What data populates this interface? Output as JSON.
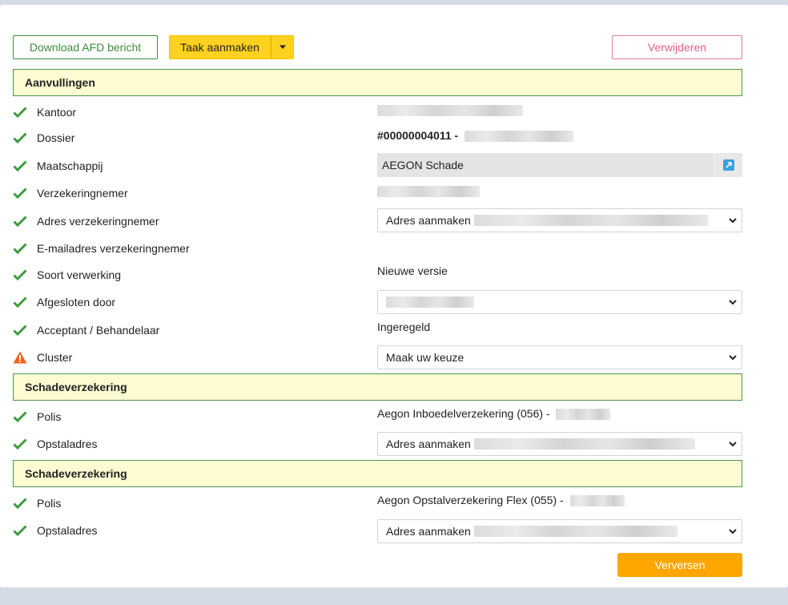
{
  "toolbar": {
    "download_label": "Download AFD bericht",
    "task_label": "Taak aanmaken",
    "delete_label": "Verwijderen"
  },
  "sections": [
    {
      "title": "Aanvullingen"
    },
    {
      "title": "Schadeverzekering"
    },
    {
      "title": "Schadeverzekering"
    }
  ],
  "aanvullingen": {
    "kantoor": {
      "label": "Kantoor"
    },
    "dossier": {
      "label": "Dossier",
      "value": "#00000004011 -"
    },
    "maatschappij": {
      "label": "Maatschappij",
      "value": "AEGON Schade"
    },
    "verzekeringnemer": {
      "label": "Verzekeringnemer"
    },
    "adres": {
      "label": "Adres verzekeringnemer",
      "value": "Adres aanmaken"
    },
    "email": {
      "label": "E-mailadres verzekeringnemer"
    },
    "soort": {
      "label": "Soort verwerking",
      "value": "Nieuwe versie"
    },
    "afgesloten": {
      "label": "Afgesloten door"
    },
    "acceptant": {
      "label": "Acceptant / Behandelaar",
      "value": "Ingeregeld"
    },
    "cluster": {
      "label": "Cluster",
      "value": "Maak uw keuze"
    }
  },
  "schade1": {
    "polis": {
      "label": "Polis",
      "value": "Aegon Inboedelverzekering (056) -"
    },
    "opstal": {
      "label": "Opstaladres",
      "value": "Adres aanmaken"
    }
  },
  "schade2": {
    "polis": {
      "label": "Polis",
      "value": "Aegon Opstalverzekering Flex (055) -"
    },
    "opstal": {
      "label": "Opstaladres",
      "value": "Adres aanmaken"
    }
  },
  "footer": {
    "refresh_label": "Verversen"
  },
  "colors": {
    "check": "#3f9a3f",
    "warning": "#f0641e",
    "section_bg": "#fdfbd1",
    "section_border": "#4f9650",
    "accent_yellow": "#ffd21f",
    "accent_orange": "#ffa600"
  },
  "icons": {
    "ok": "check-icon",
    "warn": "warning-icon",
    "dropdown": "chevron-down-icon",
    "external": "external-link-icon"
  }
}
